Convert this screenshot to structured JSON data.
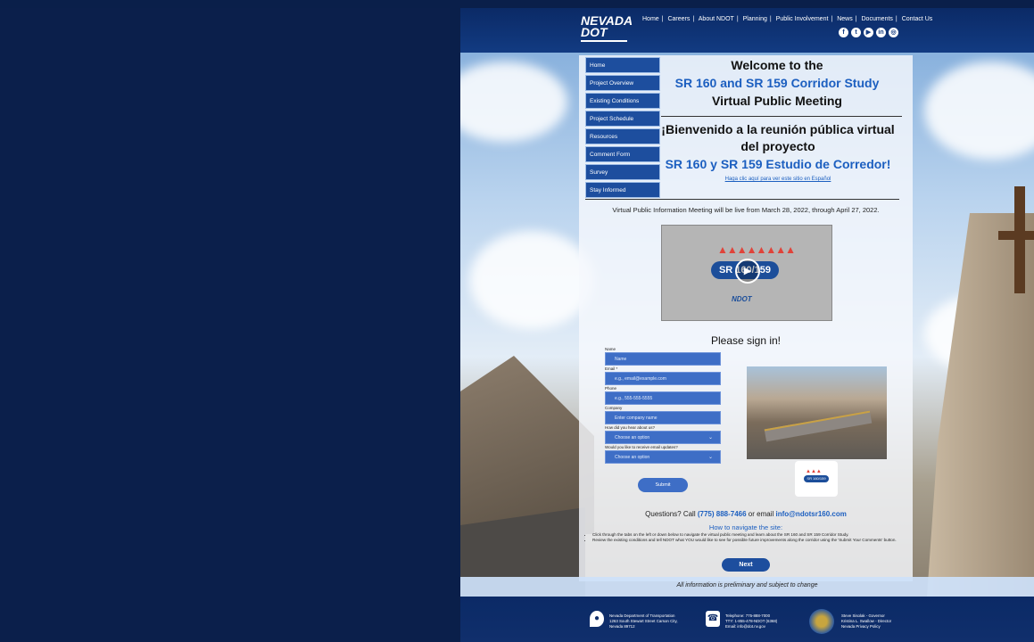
{
  "topnav": {
    "logo_main": "NEVADA\nDOT",
    "logo_sub": "",
    "links": [
      "Home",
      "Careers",
      "About NDOT",
      "Planning",
      "Public Involvement",
      "News",
      "Documents",
      "Contact Us"
    ],
    "social_icons": [
      "facebook-icon",
      "twitter-icon",
      "youtube-icon",
      "linkedin-icon",
      "instagram-icon"
    ]
  },
  "sidenav": {
    "items": [
      "Home",
      "Project Overview",
      "Existing Conditions",
      "Project Schedule",
      "Resources",
      "Comment Form",
      "Survey",
      "Stay Informed"
    ]
  },
  "welcome": {
    "line1": "Welcome to the",
    "line2": "SR 160 and SR 159 Corridor Study",
    "line3": "Virtual Public Meeting"
  },
  "spanish": {
    "line1": "¡Bienvenido a la reunión pública virtual",
    "line2": "del proyecto",
    "line3": "SR 160 y SR 159 Estudio de Corredor!",
    "link": "Haga clic aquí para ver este sitio en Español"
  },
  "live_notice": "Virtual Public Information Meeting will be live from March 28, 2022, through April 27, 2022.",
  "video": {
    "badge": "SR 160/159",
    "play_glyph": "▶"
  },
  "signin": {
    "title": "Please sign in!",
    "fields": [
      {
        "label": "Name",
        "placeholder": "Name"
      },
      {
        "label": "Email *",
        "placeholder": "e.g., email@example.com"
      },
      {
        "label": "Phone",
        "placeholder": "e.g., 555-555-5555"
      },
      {
        "label": "Company",
        "placeholder": "Enter company name"
      }
    ],
    "selects": [
      {
        "label": "How did you hear about us?",
        "value": "Choose an option"
      },
      {
        "label": "Would you like to receive email updates?",
        "value": "Choose an option"
      }
    ],
    "submit": "Submit"
  },
  "contact": {
    "prefix": "Questions? Call ",
    "phone": "(775) 888-7466",
    "middle": " or email ",
    "email": "info@ndotsr160.com"
  },
  "howto": {
    "title": "How to navigate the site:",
    "bullets": [
      "Click through the tabs on the left or down below to navigate the virtual public meeting and learn about the SR 160 and SR 159 Corridor Study.",
      "Review the existing conditions and tell NDOT what YOU would like to see for possible future improvements along the corridor using the 'Submit Your Comments' button."
    ]
  },
  "next_button": "Next",
  "disclaimer": "All information is preliminary and subject to change",
  "footer": {
    "address": [
      "Nevada Department of Transportation",
      "1263 South Stewart Street Carson City,",
      "Nevada 89712"
    ],
    "phones": [
      "Telephone: 775-888-7000",
      "TTY: 1-855-478-NDOT (6368)",
      "Email: info@dot.nv.gov"
    ],
    "officials": [
      "Steve Sisolak - Governor",
      "Kristina L. Swallow - Director",
      "Nevada Privacy Policy"
    ]
  }
}
